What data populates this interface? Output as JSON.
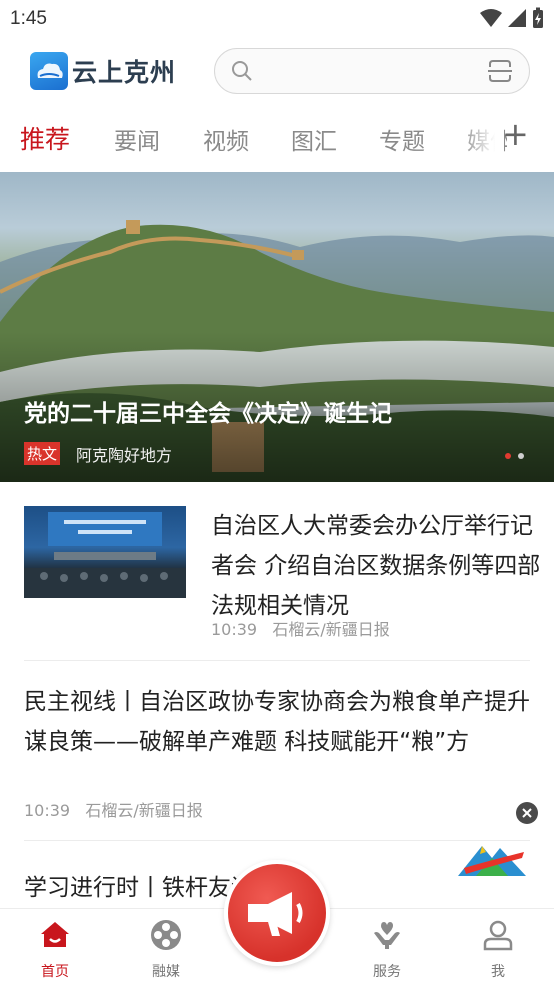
{
  "status_bar": {
    "time": "1:45"
  },
  "header": {
    "app_name": "云上克州",
    "search": {
      "placeholder": ""
    }
  },
  "tabs": [
    {
      "label": "推荐",
      "active": true
    },
    {
      "label": "要闻"
    },
    {
      "label": "视频"
    },
    {
      "label": "图汇"
    },
    {
      "label": "专题"
    },
    {
      "label": "媒体"
    }
  ],
  "banner": {
    "title": "党的二十届三中全会《决定》诞生记",
    "tag": "热文",
    "source": "阿克陶好地方",
    "slide_count": 2,
    "active_slide": 1
  },
  "news": [
    {
      "title": "自治区人大常委会办公厅举行记者会 介绍自治区数据条例等四部法规相关情况",
      "time": "10:39",
      "source": "石榴云/新疆日报"
    },
    {
      "title": "民主视线丨自治区政协专家协商会为粮食单产提升谋良策——破解单产难题 科技赋能开“粮”方",
      "time": "10:39",
      "source": "石榴云/新疆日报"
    },
    {
      "title": "学习进行时丨铁杆友谊 情深"
    }
  ],
  "bottom_nav": [
    {
      "label": "首页",
      "icon": "home-icon",
      "active": true
    },
    {
      "label": "融媒",
      "icon": "film-reel-icon"
    },
    {
      "label": "",
      "icon": "megaphone-icon"
    },
    {
      "label": "服务",
      "icon": "heart-hand-icon"
    },
    {
      "label": "我",
      "icon": "user-icon"
    }
  ],
  "colors": {
    "accent": "#c8161d",
    "tag_bg": "#d9342b",
    "muted": "#9a9a9a"
  }
}
